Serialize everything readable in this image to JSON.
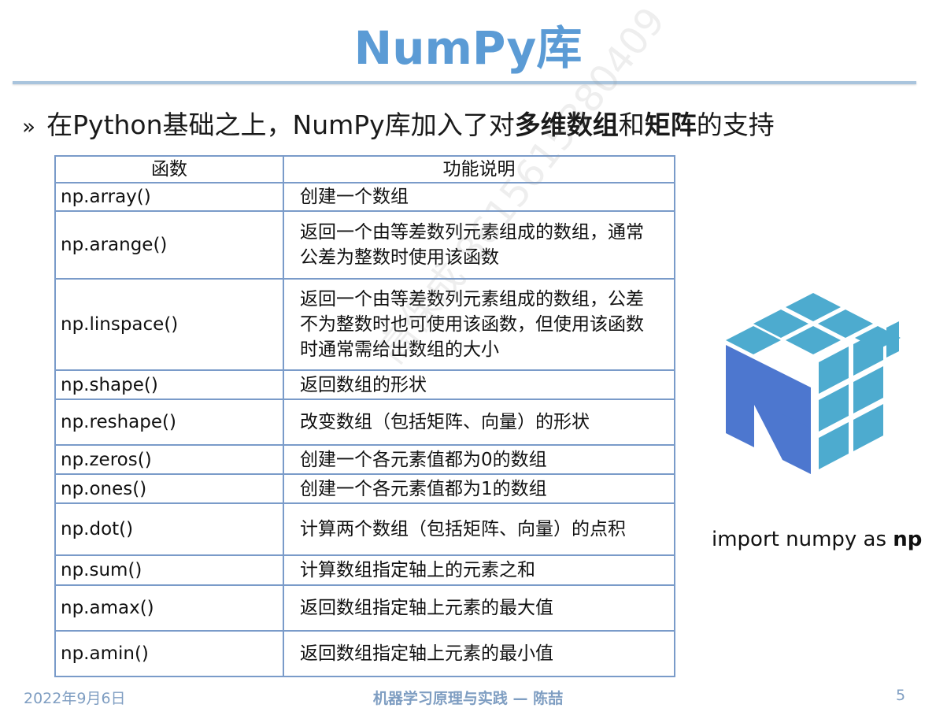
{
  "title": "NumPy库",
  "bullet": {
    "mark": "»",
    "prefix": "在Python基础之上，NumPy库加入了对",
    "bold1": "多维数组",
    "mid": "和",
    "bold2": "矩阵",
    "suffix": "的支持"
  },
  "table": {
    "headers": [
      "函数",
      "功能说明"
    ],
    "rows": [
      {
        "fn": "np.array()",
        "desc": "创建一个数组"
      },
      {
        "fn": "np.arange()",
        "desc": "返回一个由等差数列元素组成的数组，通常公差为整数时使用该函数"
      },
      {
        "fn": "np.linspace()",
        "desc": "返回一个由等差数列元素组成的数组，公差不为整数时也可使用该函数，但使用该函数时通常需给出数组的大小"
      },
      {
        "fn": "np.shape()",
        "desc": "返回数组的形状"
      },
      {
        "fn": "np.reshape()",
        "desc": "改变数组（包括矩阵、向量）的形状"
      },
      {
        "fn": "np.zeros()",
        "desc": "创建一个各元素值都为0的数组"
      },
      {
        "fn": "np.ones()",
        "desc": "创建一个各元素值都为1的数组"
      },
      {
        "fn": "np.dot()",
        "desc": "计算两个数组（包括矩阵、向量）的点积"
      },
      {
        "fn": "np.sum()",
        "desc": "计算数组指定轴上的元素之和"
      },
      {
        "fn": "np.amax()",
        "desc": "返回数组指定轴上元素的最大值"
      },
      {
        "fn": "np.amin()",
        "desc": "返回数组指定轴上元素的最小值"
      }
    ]
  },
  "watermark": "高保成 8615615380409",
  "logo_icon": "numpy-logo",
  "import_line": {
    "prefix": "import numpy as ",
    "alias": "np"
  },
  "footer": {
    "date": "2022年9月6日",
    "center": "机器学习原理与实践 — 陈喆",
    "page": "5"
  },
  "colors": {
    "title": "#5b9bd5",
    "table_border": "#7a9bc9",
    "footer": "#7f9ec2",
    "logo_dark": "#4d77cf",
    "logo_light": "#4dabcf"
  }
}
